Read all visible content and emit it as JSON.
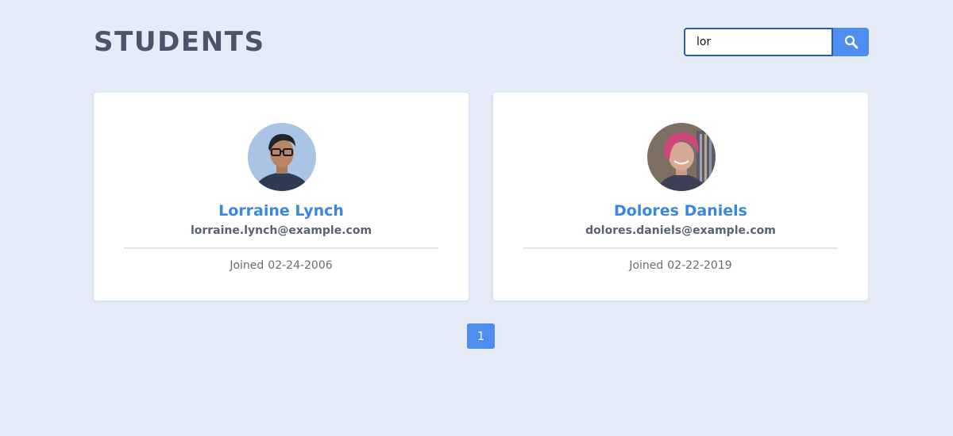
{
  "page": {
    "title": "STUDENTS"
  },
  "search": {
    "value": "lor",
    "icon": "search-icon"
  },
  "students": [
    {
      "name": "Lorraine Lynch",
      "email": "lorraine.lynch@example.com",
      "joined_label": "Joined",
      "joined_date": "02-24-2006"
    },
    {
      "name": "Dolores Daniels",
      "email": "dolores.daniels@example.com",
      "joined_label": "Joined",
      "joined_date": "02-22-2019"
    }
  ],
  "pagination": {
    "pages": [
      "1"
    ],
    "current": "1"
  },
  "colors": {
    "background": "#e5ebf7",
    "accent": "#4d8ef0",
    "name": "#3a86e3",
    "title": "#4a5568"
  }
}
